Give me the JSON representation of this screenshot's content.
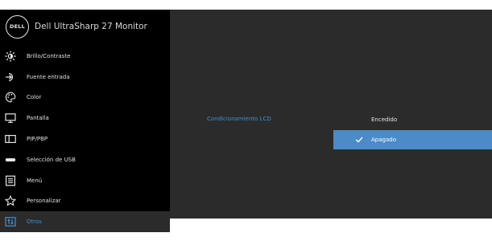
{
  "brand": {
    "logo_text": "DELL",
    "model": "Dell UltraSharp 27 Monitor"
  },
  "colors": {
    "sidebar_bg": "#000000",
    "panel_bg": "#2b2b2b",
    "accent": "#3d93d9",
    "selected_bg": "#4a8bc8"
  },
  "menu": {
    "items": [
      {
        "label": "Brillo/Contraste",
        "icon": "brightness-icon"
      },
      {
        "label": "Fuente entrada",
        "icon": "input-source-icon"
      },
      {
        "label": "Color",
        "icon": "color-palette-icon"
      },
      {
        "label": "Pantalla",
        "icon": "display-icon"
      },
      {
        "label": "PIP/PBP",
        "icon": "pip-pbp-icon"
      },
      {
        "label": "Selección de USB",
        "icon": "usb-icon"
      },
      {
        "label": "Menú",
        "icon": "menu-icon"
      },
      {
        "label": "Personalizar",
        "icon": "star-icon"
      },
      {
        "label": "Otros",
        "icon": "others-icon",
        "active": true
      }
    ]
  },
  "content": {
    "setting_label": "Condicionamiento LCD",
    "options": [
      {
        "label": "Encedido",
        "selected": false
      },
      {
        "label": "Apagado",
        "selected": true
      }
    ]
  }
}
